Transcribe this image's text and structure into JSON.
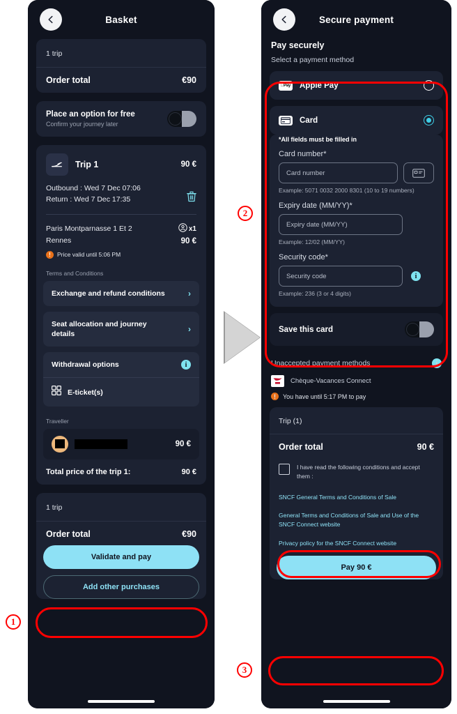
{
  "basket": {
    "title": "Basket",
    "back_icon": "chevron-left-icon",
    "summary_top": {
      "trips_label": "1 trip",
      "order_total_label": "Order total",
      "order_total_value": "€90"
    },
    "option": {
      "title": "Place an option for free",
      "subtitle": "Confirm your journey later",
      "toggle_state": "off"
    },
    "trip": {
      "icon": "train-icon",
      "name": "Trip 1",
      "price": "90 €",
      "outbound": "Outbound : Wed 7 Dec 07:06",
      "return": "Return : Wed 7 Dec 17:35",
      "delete_icon": "trash-icon",
      "origin": "Paris Montparnasse 1 Et 2",
      "destination": "Rennes",
      "passengers": "x1",
      "passenger_icon": "person-icon",
      "leg_price": "90 €",
      "warning": "Price valid until 5:06 PM",
      "warning_icon": "alert-icon"
    },
    "terms_label": "Terms and Conditions",
    "terms_items": [
      {
        "label": "Exchange and refund conditions",
        "accessory": "chevron-right-icon"
      },
      {
        "label": "Seat allocation and journey details",
        "accessory": "chevron-right-icon"
      },
      {
        "label": "Withdrawal options",
        "accessory": "info-icon"
      },
      {
        "label": "E-ticket(s)",
        "accessory": "qr-code-icon"
      }
    ],
    "traveller_label": "Traveller",
    "traveller": {
      "name": "",
      "price": "90 €",
      "avatar_icon": "avatar-redacted"
    },
    "trip_total_label": "Total price of the trip 1:",
    "trip_total_value": "90 €",
    "summary_bottom": {
      "trips_label": "1 trip",
      "order_total_label": "Order total",
      "order_total_value": "€90"
    },
    "primary_button": "Validate and pay",
    "secondary_button": "Add other purchases"
  },
  "payment": {
    "title": "Secure payment",
    "back_icon": "chevron-left-icon",
    "heading": "Pay securely",
    "subheading": "Select a payment method",
    "methods": [
      {
        "label": "Apple Pay",
        "icon": "apple-pay-icon",
        "selected": false
      },
      {
        "label": "Card",
        "icon": "credit-card-icon",
        "selected": true
      }
    ],
    "form": {
      "required_note": "*All fields must be filled in",
      "card_number_label": "Card number*",
      "card_number_placeholder": "Card number",
      "card_number_hint": "Example: 5071 0032 2000 8301 (10 to 19 numbers)",
      "scan_icon": "card-scan-icon",
      "expiry_label": "Expiry date (MM/YY)*",
      "expiry_placeholder": "Expiry date (MM/YY)",
      "expiry_hint": "Example: 12/02 (MM/YY)",
      "security_label": "Security code*",
      "security_placeholder": "Security code",
      "security_hint": "Example: 236 (3 or 4 digits)",
      "security_info_icon": "info-icon"
    },
    "save_card": {
      "label": "Save this card",
      "toggle_state": "off"
    },
    "unaccepted": {
      "label": "Unaccepted payment methods",
      "info_icon": "info-icon"
    },
    "cheque_vacances": {
      "label": "Chèque-Vacances Connect",
      "icon": "sncf-logo-icon"
    },
    "timer": {
      "text": "You have until 5:17 PM to pay",
      "icon": "alert-icon"
    },
    "summary": {
      "trips_label": "Trip (1)",
      "order_total_label": "Order total",
      "order_total_value": "90 €"
    },
    "consent": {
      "text": "I have read the following conditions and accept them :",
      "checked": false
    },
    "links": [
      "SNCF General Terms and Conditions of Sale",
      "General Terms and Conditions of Sale and Use of the SNCF Connect website",
      "Privacy policy for the SNCF Connect website"
    ],
    "pay_button": "Pay 90 €"
  },
  "annotations": {
    "markers": [
      {
        "id": "1",
        "label": "1"
      },
      {
        "id": "2",
        "label": "2"
      },
      {
        "id": "3",
        "label": "3"
      }
    ],
    "highlight_color": "#ff0000",
    "flow_arrow_icon": "triangle-right-icon"
  }
}
